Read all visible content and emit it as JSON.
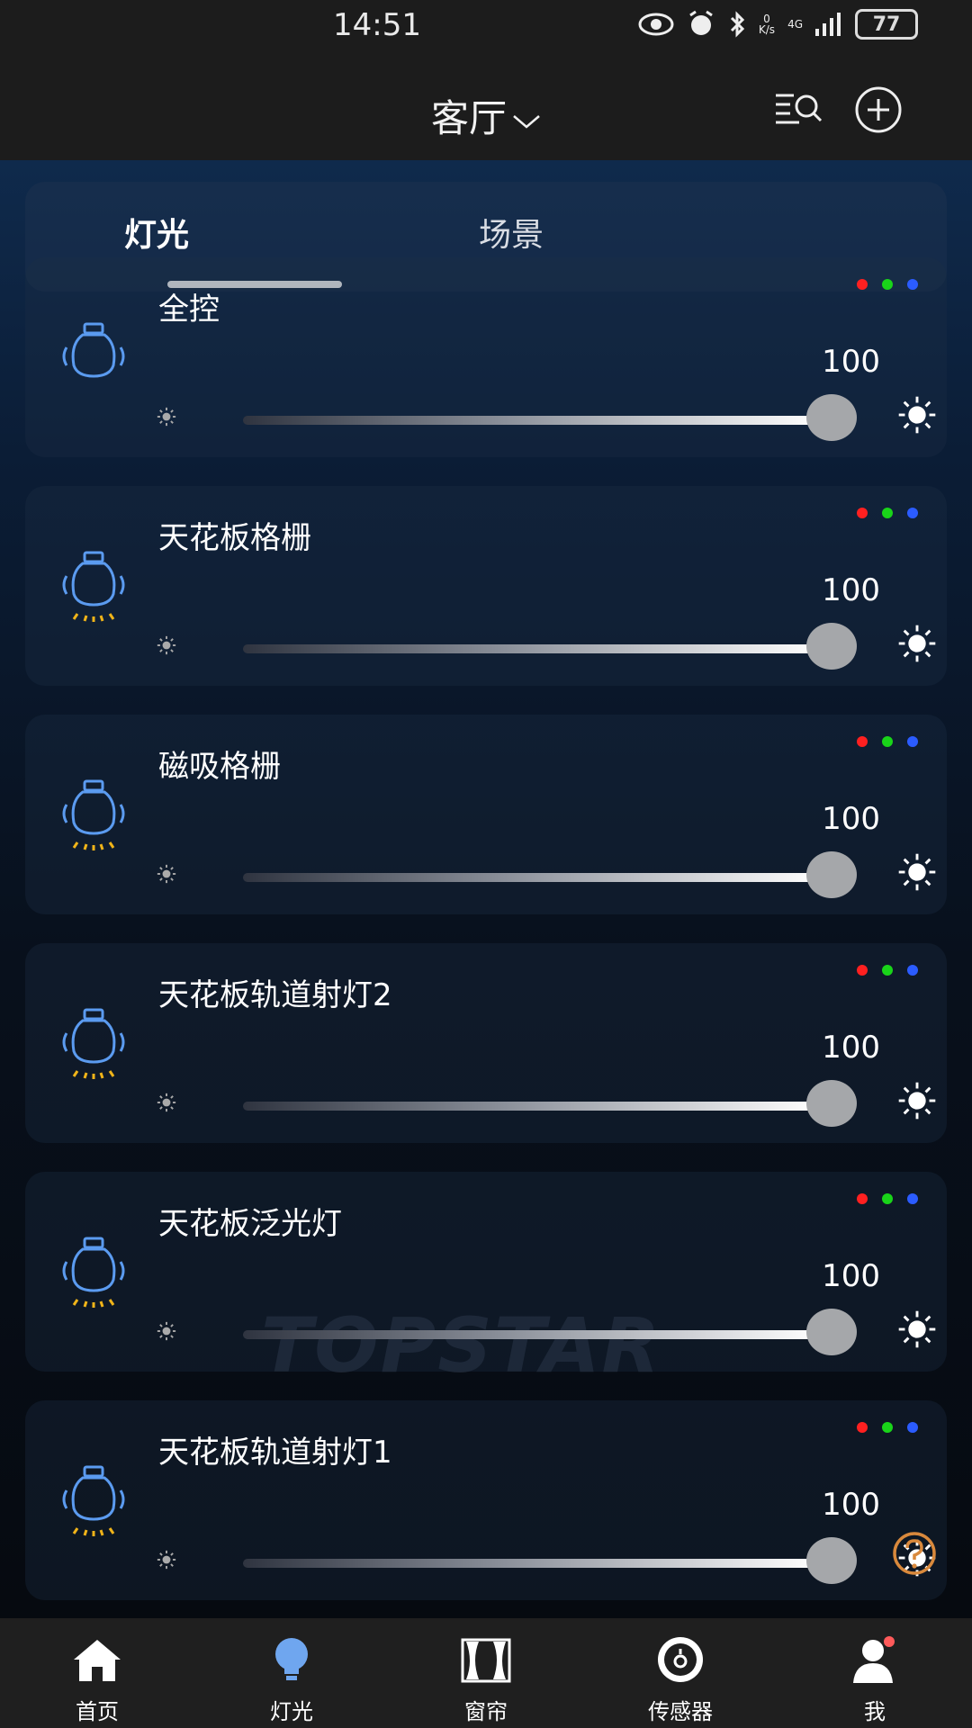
{
  "status_bar": {
    "time": "14:51",
    "netspeed_value": "0",
    "netspeed_unit": "K/s",
    "network": "4G",
    "battery": "77",
    "icons": [
      "eye-icon",
      "alarm-icon",
      "bluetooth-icon",
      "signal-icon",
      "battery-icon"
    ]
  },
  "header": {
    "room": "客厅",
    "icons": [
      "chevron-down-icon",
      "search-list-icon",
      "add-circle-icon"
    ]
  },
  "tabs": [
    {
      "label": "灯光",
      "active": true
    },
    {
      "label": "场景",
      "active": false
    }
  ],
  "watermark": "TOPSTAR",
  "lights": [
    {
      "name": "全控",
      "value": "100",
      "level": 1.0,
      "rays": false
    },
    {
      "name": "天花板格栅",
      "value": "100",
      "level": 1.0,
      "rays": true
    },
    {
      "name": "磁吸格栅",
      "value": "100",
      "level": 1.0,
      "rays": true
    },
    {
      "name": "天花板轨道射灯2",
      "value": "100",
      "level": 1.0,
      "rays": true
    },
    {
      "name": "天花板泛光灯",
      "value": "100",
      "level": 1.0,
      "rays": true
    },
    {
      "name": "天花板轨道射灯1",
      "value": "100",
      "level": 1.0,
      "rays": true
    }
  ],
  "colors": {
    "accent_blue": "#5b9bf0",
    "ray_yellow": "#f0b419",
    "dot_red": "#ff2020",
    "dot_green": "#19d419",
    "dot_blue": "#2b5cff",
    "help_orange": "#d9893c"
  },
  "bottom_nav": [
    {
      "label": "首页",
      "icon": "home-icon"
    },
    {
      "label": "灯光",
      "icon": "bulb-icon"
    },
    {
      "label": "窗帘",
      "icon": "curtain-icon"
    },
    {
      "label": "传感器",
      "icon": "sensor-icon"
    },
    {
      "label": "我",
      "icon": "profile-icon"
    }
  ]
}
